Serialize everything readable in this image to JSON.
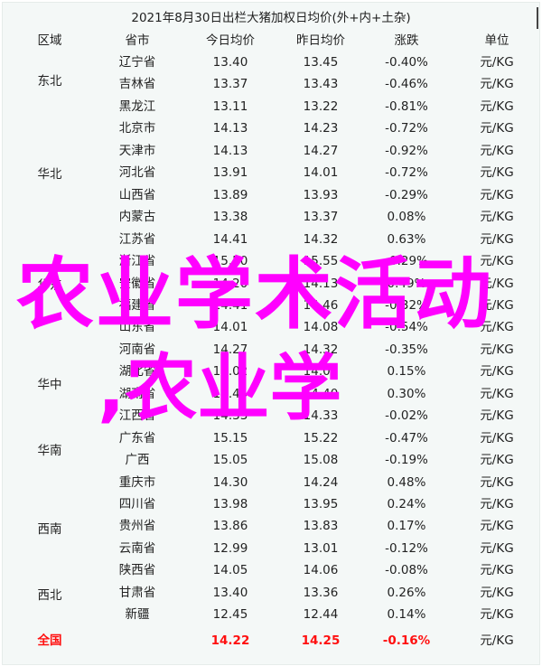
{
  "table": {
    "title": "2021年8月30日出栏大猪加权日均价(外+内+土杂)",
    "columns": [
      "区域",
      "省市",
      "今日均价",
      "昨日均价",
      "涨跌",
      "单位"
    ],
    "regions": [
      {
        "name": "东北"
      },
      {
        "name": "华北"
      },
      {
        "name": "华东"
      },
      {
        "name": "华中"
      },
      {
        "name": "华南"
      },
      {
        "name": "西南"
      },
      {
        "name": "西北"
      }
    ],
    "rows": [
      {
        "province": "辽宁省",
        "today": "13.40",
        "yesterday": "13.45",
        "change": "-0.40%",
        "unit": "元/KG"
      },
      {
        "province": "吉林省",
        "today": "13.37",
        "yesterday": "13.43",
        "change": "-0.46%",
        "unit": "元/KG"
      },
      {
        "province": "黑龙江",
        "today": "13.11",
        "yesterday": "13.22",
        "change": "-0.81%",
        "unit": "元/KG"
      },
      {
        "province": "北京市",
        "today": "14.13",
        "yesterday": "14.23",
        "change": "-0.72%",
        "unit": "元/KG"
      },
      {
        "province": "天津市",
        "today": "14.13",
        "yesterday": "14.27",
        "change": "-0.92%",
        "unit": "元/KG"
      },
      {
        "province": "河北省",
        "today": "13.91",
        "yesterday": "14.01",
        "change": "-0.72%",
        "unit": "元/KG"
      },
      {
        "province": "山西省",
        "today": "13.89",
        "yesterday": "13.93",
        "change": "-0.29%",
        "unit": "元/KG"
      },
      {
        "province": "内蒙古",
        "today": "13.38",
        "yesterday": "13.37",
        "change": "0.08%",
        "unit": "元/KG"
      },
      {
        "province": "江苏省",
        "today": "14.41",
        "yesterday": "14.32",
        "change": "0.63%",
        "unit": "元/KG"
      },
      {
        "province": "浙江省",
        "today": "15.50",
        "yesterday": "15.55",
        "change": "-0.29%",
        "unit": "元/KG"
      },
      {
        "province": "安徽省",
        "today": "14.20",
        "yesterday": "14.13",
        "change": "0.49%",
        "unit": "元/KG"
      },
      {
        "province": "福建省",
        "today": "14.41",
        "yesterday": "14.46",
        "change": "-0.32%",
        "unit": "元/KG"
      },
      {
        "province": "山东省",
        "today": "14.01",
        "yesterday": "14.08",
        "change": "-0.54%",
        "unit": "元/KG"
      },
      {
        "province": "河南省",
        "today": "14.27",
        "yesterday": "14.32",
        "change": "-0.35%",
        "unit": "元/KG"
      },
      {
        "province": "湖北省",
        "today": "14.02",
        "yesterday": "14.00",
        "change": "0.15%",
        "unit": "元/KG"
      },
      {
        "province": "湖南省",
        "today": "14.45",
        "yesterday": "14.40",
        "change": "0.30%",
        "unit": "元/KG"
      },
      {
        "province": "江西省",
        "today": "14.33",
        "yesterday": "14.33",
        "change": "-0.02%",
        "unit": "元/KG"
      },
      {
        "province": "广东省",
        "today": "15.15",
        "yesterday": "15.22",
        "change": "-0.47%",
        "unit": "元/KG"
      },
      {
        "province": "广西",
        "today": "15.05",
        "yesterday": "15.08",
        "change": "-0.19%",
        "unit": "元/KG"
      },
      {
        "province": "重庆市",
        "today": "14.30",
        "yesterday": "14.24",
        "change": "0.48%",
        "unit": "元/KG"
      },
      {
        "province": "四川省",
        "today": "13.98",
        "yesterday": "13.95",
        "change": "0.24%",
        "unit": "元/KG"
      },
      {
        "province": "贵州省",
        "today": "13.86",
        "yesterday": "13.83",
        "change": "0.17%",
        "unit": "元/KG"
      },
      {
        "province": "云南省",
        "today": "12.99",
        "yesterday": "13.01",
        "change": "-0.12%",
        "unit": "元/KG"
      },
      {
        "province": "陕西省",
        "today": "14.05",
        "yesterday": "14.06",
        "change": "-0.08%",
        "unit": "元/KG"
      },
      {
        "province": "甘肃省",
        "today": "13.40",
        "yesterday": "13.36",
        "change": "0.26%",
        "unit": "元/KG"
      },
      {
        "province": "新疆",
        "today": "12.45",
        "yesterday": "12.44",
        "change": "0.14%",
        "unit": "元/KG"
      }
    ],
    "total": {
      "region": "全国",
      "province": "",
      "today": "14.22",
      "yesterday": "14.25",
      "change": "-0.16%",
      "unit": "元/KG"
    }
  },
  "overlay": {
    "line1": "农业学术活动",
    "line2": ",农业学",
    "color": "#ff00ff"
  },
  "colors": {
    "total_highlight": "#ff1010",
    "background": "#f4f8f7"
  }
}
